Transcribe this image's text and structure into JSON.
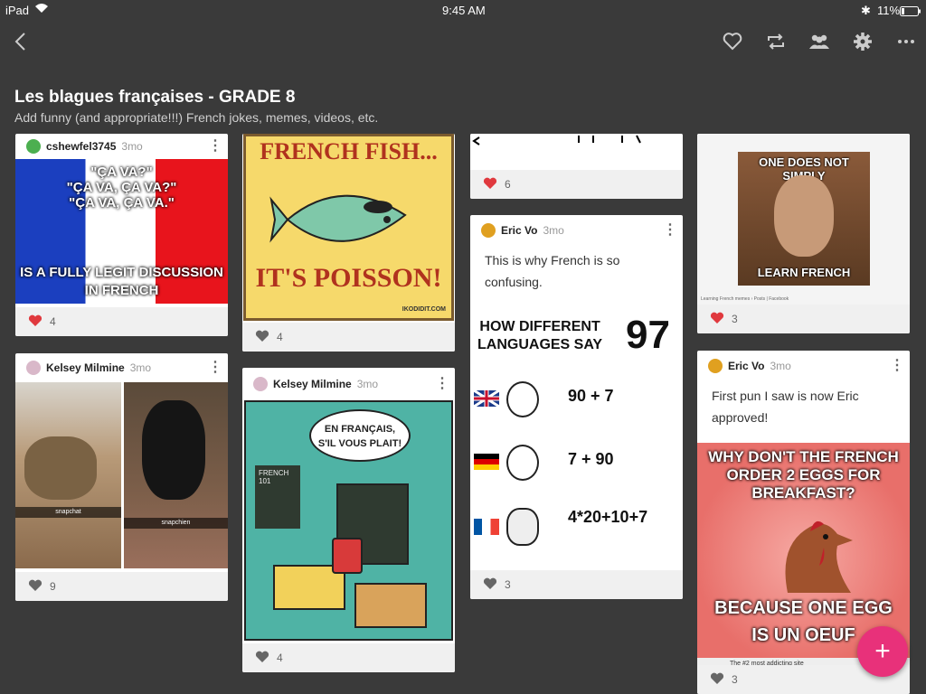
{
  "status": {
    "device": "iPad",
    "time": "9:45 AM",
    "battery": "11%"
  },
  "topbar": {
    "icons": [
      "back-icon",
      "heart-icon",
      "remix-icon",
      "people-icon",
      "gear-icon",
      "more-icon"
    ]
  },
  "header": {
    "title": "Les blagues françaises - GRADE 8",
    "subtitle": "Add funny (and appropriate!!!) French jokes, memes, videos, etc."
  },
  "colors": {
    "background": "#3a3a3a",
    "fab": "#e8317a",
    "liked": "#e0393e",
    "unliked": "#666666"
  },
  "posts": {
    "p1": {
      "author": "cshewfel3745",
      "age": "3mo",
      "likes": "4",
      "liked": true,
      "meme_lines": [
        "\"ÇA VA?\"",
        "\"ÇA VA, ÇA VA?\"",
        "\"ÇA VA, ÇA VA.\""
      ],
      "meme_bottom": [
        "IS A FULLY LEGIT DISCUSSION",
        "IN FRENCH"
      ]
    },
    "p2": {
      "author": "Kelsey Milmine",
      "age": "3mo",
      "likes": "9",
      "liked": false,
      "label_left": "snapchat",
      "label_right": "snapchien"
    },
    "p3": {
      "likes": "4",
      "liked": false,
      "meme_top": "FRENCH FISH...",
      "meme_bottom": "IT'S POISSON!",
      "credit": "IKODIDIT.COM"
    },
    "p4": {
      "author": "Kelsey Milmine",
      "age": "3mo",
      "likes": "4",
      "liked": false,
      "bubble": [
        "EN FRANÇAIS,",
        "S'IL VOUS PLAIT!"
      ],
      "board": [
        "FRENCH",
        "101"
      ]
    },
    "p5": {
      "likes": "6",
      "liked": true
    },
    "p6": {
      "author": "Eric Vo",
      "age": "3mo",
      "likes": "3",
      "liked": false,
      "text": "This is why French is so confusing.",
      "meme_title": [
        "HOW DIFFERENT",
        "LANGUAGES SAY"
      ],
      "meme_number": "97",
      "rows": [
        "90 + 7",
        "7 + 90",
        "4*20+10+7"
      ]
    },
    "p7": {
      "likes": "3",
      "liked": true,
      "meme_top": "ONE DOES NOT SIMPLY",
      "meme_bottom": "LEARN FRENCH",
      "page_caption": "Learning French memes › Posts | Facebook"
    },
    "p8": {
      "author": "Eric Vo",
      "age": "3mo",
      "likes": "3",
      "liked": false,
      "text": "First pun I saw is now Eric approved!",
      "meme_top": [
        "WHY DON'T THE FRENCH",
        "ORDER 2 EGGS FOR",
        "BREAKFAST?"
      ],
      "meme_bottom": [
        "BECAUSE ONE EGG",
        "IS UN OEUF"
      ],
      "footer_caption": "The #2 most addicting site"
    }
  },
  "fab": {
    "label": "+"
  }
}
